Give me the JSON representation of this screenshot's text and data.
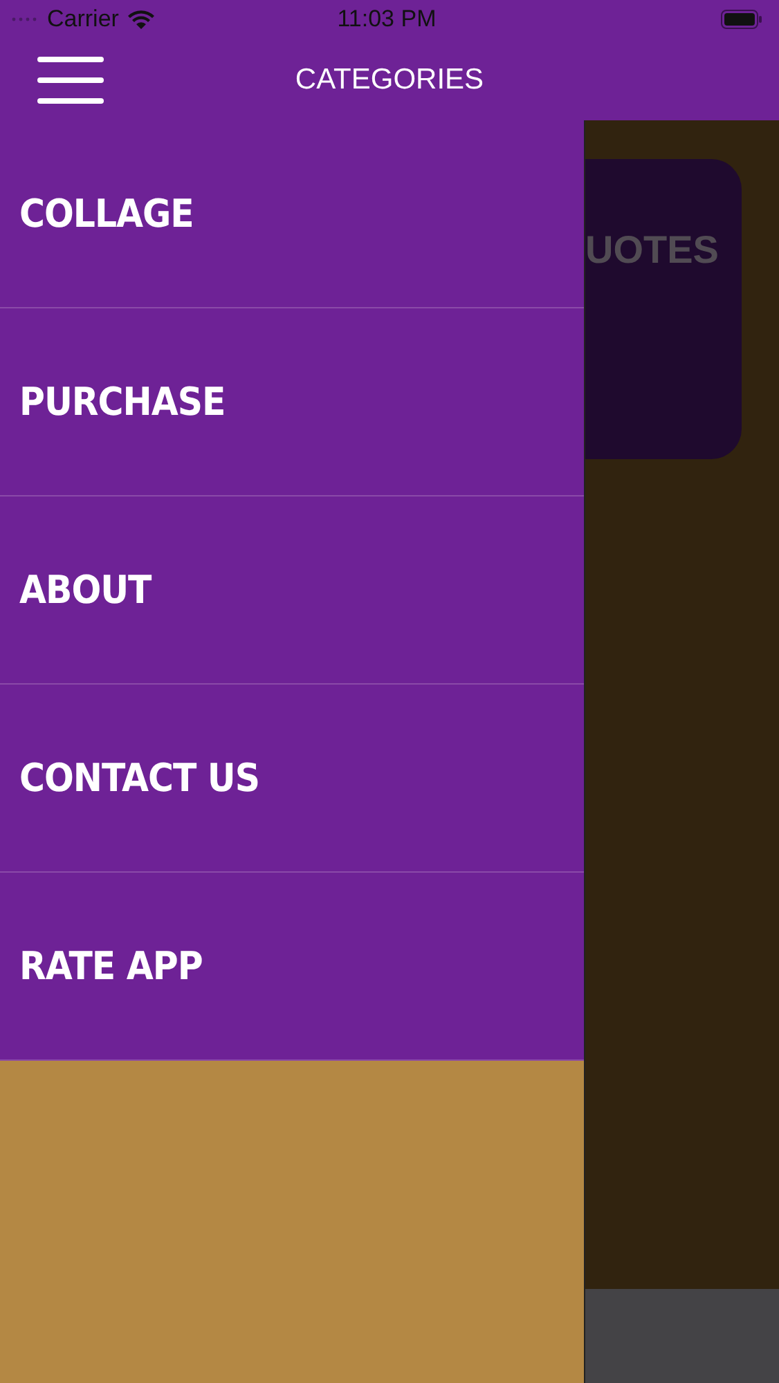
{
  "status_bar": {
    "carrier": "Carrier",
    "time": "11:03 PM"
  },
  "nav_bar": {
    "title": "CATEGORIES"
  },
  "drawer": {
    "items": [
      {
        "label": "COLLAGE"
      },
      {
        "label": "PURCHASE"
      },
      {
        "label": "ABOUT"
      },
      {
        "label": "CONTACT US"
      },
      {
        "label": "RATE APP"
      }
    ]
  },
  "background": {
    "card_title": "UOTES"
  }
}
